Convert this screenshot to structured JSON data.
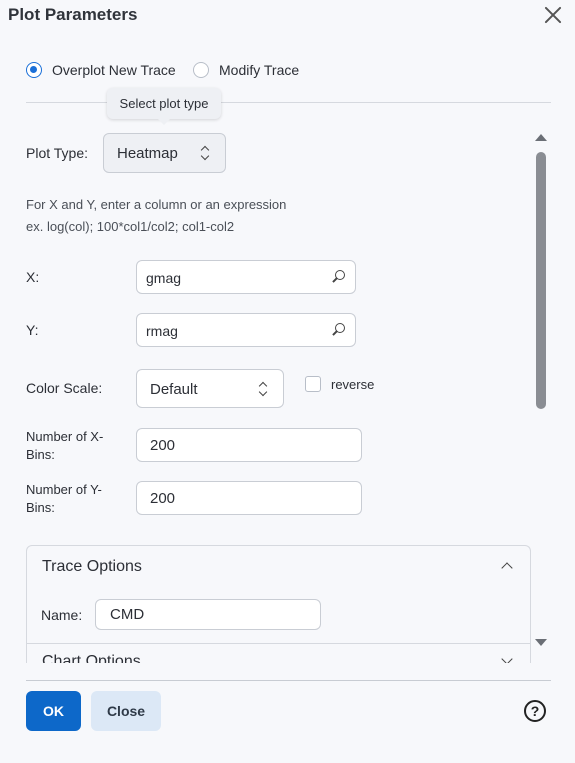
{
  "dialog": {
    "title": "Plot Parameters"
  },
  "mode": {
    "options": [
      {
        "label": "Overplot New Trace",
        "selected": true
      },
      {
        "label": "Modify Trace",
        "selected": false
      }
    ]
  },
  "tooltip": "Select plot type",
  "plot_type": {
    "label": "Plot Type:",
    "value": "Heatmap"
  },
  "hint": {
    "line1": "For X and Y, enter a column or an expression",
    "line2": "ex. log(col); 100*col1/col2; col1-col2"
  },
  "x_field": {
    "label": "X:",
    "value": "gmag",
    "icon": "search-icon"
  },
  "y_field": {
    "label": "Y:",
    "value": "rmag",
    "icon": "search-icon"
  },
  "color_scale": {
    "label": "Color Scale:",
    "value": "Default",
    "reverse_label": "reverse",
    "reverse_checked": false
  },
  "x_bins": {
    "label_line1": "Number of X-",
    "label_line2": "Bins:",
    "value": "200"
  },
  "y_bins": {
    "label_line1": "Number of Y-",
    "label_line2": "Bins:",
    "value": "200"
  },
  "trace_options": {
    "title": "Trace Options",
    "name_label": "Name:",
    "name_value": "CMD",
    "next_section_title": "Chart Options"
  },
  "footer": {
    "ok_label": "OK",
    "close_label": "Close",
    "help_label": "?"
  },
  "colors": {
    "accent": "#0d68c9",
    "secondary_button": "#dce8f6",
    "background": "#f7f8fb"
  }
}
